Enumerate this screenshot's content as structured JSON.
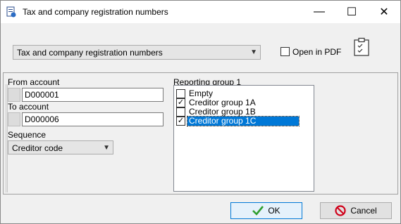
{
  "window": {
    "title": "Tax and company registration numbers",
    "controls": {
      "minimize": "—",
      "maximize": "☐",
      "close": "✕"
    }
  },
  "report_select": {
    "value": "Tax and company registration numbers"
  },
  "open_in_pdf": {
    "label": "Open in PDF",
    "checked": false
  },
  "from_account": {
    "label": "From account",
    "value": "D000001"
  },
  "to_account": {
    "label": "To account",
    "value": "D000006"
  },
  "sequence": {
    "label": "Sequence",
    "value": "Creditor code"
  },
  "reporting_group": {
    "label": "Reporting group 1",
    "items": [
      {
        "label": "Empty",
        "checked": false,
        "selected": false
      },
      {
        "label": "Creditor group 1A",
        "checked": true,
        "selected": false
      },
      {
        "label": "Creditor group 1B",
        "checked": false,
        "selected": false
      },
      {
        "label": "Creditor group 1C",
        "checked": true,
        "selected": true
      }
    ]
  },
  "buttons": {
    "ok_label": "OK",
    "cancel_label": "Cancel"
  },
  "icons": {
    "app": "report-app-icon",
    "clipboard": "clipboard-checklist-icon",
    "ok": "checkmark-icon",
    "cancel": "no-entry-icon"
  },
  "colors": {
    "selection": "#0078d7",
    "ok_icon": "#2e9e2e",
    "cancel_icon": "#d0021b"
  }
}
